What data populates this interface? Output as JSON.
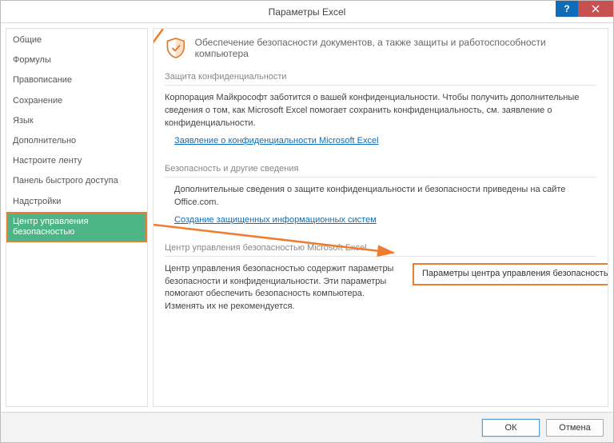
{
  "title": "Параметры Excel",
  "sidebar": {
    "items": [
      {
        "label": "Общие"
      },
      {
        "label": "Формулы"
      },
      {
        "label": "Правописание"
      },
      {
        "label": "Сохранение"
      },
      {
        "label": "Язык"
      },
      {
        "label": "Дополнительно"
      },
      {
        "label": "Настроите ленту"
      },
      {
        "label": "Панель быстрого доступа"
      },
      {
        "label": "Надстройки"
      },
      {
        "label": "Центр управления безопасностью"
      }
    ],
    "selected_index": 9
  },
  "main": {
    "shield_text": "Обеспечение безопасности документов, а также защиты и работоспособности компьютера",
    "sections": {
      "privacy": {
        "head": "Защита конфиденциальности",
        "body": "Корпорация Майкрософт заботится о вашей конфиденциальности. Чтобы получить дополнительные сведения о том, как Microsoft Excel помогает сохранить конфиденциальность, см. заявление о конфиденциальности.",
        "link": "Заявление о конфиденциальности Microsoft Excel"
      },
      "security": {
        "head": "Безопасность и другие сведения",
        "body": "Дополнительные сведения о защите конфиденциальности и безопасности приведены на сайте Office.com.",
        "link": "Создание защищенных информационных систем"
      },
      "trust": {
        "head": "Центр управления безопасностью Microsoft Excel",
        "body": "Центр управления безопасностью содержит параметры безопасности и конфиденциальности. Эти параметры помогают обеспечить безопасность компьютера. Изменять их не рекомендуется.",
        "button": "Параметры центра управления безопасностью..."
      }
    }
  },
  "footer": {
    "ok": "ОК",
    "cancel": "Отмена"
  },
  "titlebar_help": "?"
}
